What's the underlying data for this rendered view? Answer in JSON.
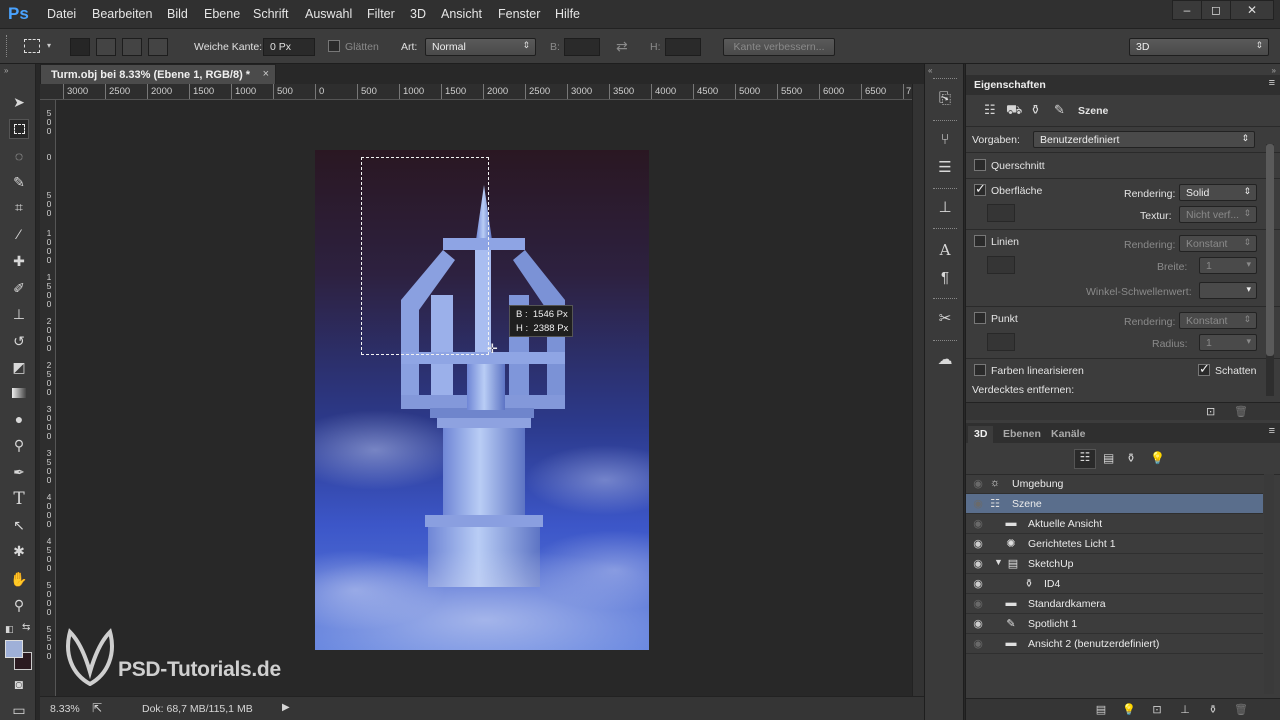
{
  "app": {
    "logo": "Ps"
  },
  "menu": [
    "Datei",
    "Bearbeiten",
    "Bild",
    "Ebene",
    "Schrift",
    "Auswahl",
    "Filter",
    "3D",
    "Ansicht",
    "Fenster",
    "Hilfe"
  ],
  "options": {
    "feather_label": "Weiche Kante:",
    "feather_value": "0 Px",
    "antialias_label": "Glätten",
    "style_label": "Art:",
    "style_value": "Normal",
    "width_label": "B:",
    "height_label": "H:",
    "refine_edge": "Kante verbessern...",
    "workspace": "3D"
  },
  "document": {
    "tab_title": "Turm.obj bei 8.33% (Ebene 1, RGB/8) *",
    "ruler_top": [
      "3000",
      "2500",
      "2000",
      "1500",
      "1000",
      "500",
      "0",
      "500",
      "1000",
      "1500",
      "2000",
      "2500",
      "3000",
      "3500",
      "4000",
      "4500",
      "5000",
      "5500",
      "6000",
      "6500",
      "7"
    ],
    "ruler_left": [
      "500",
      "0",
      "500",
      "1000",
      "1500",
      "2000",
      "2500",
      "3000",
      "3500",
      "4000",
      "4500",
      "5000",
      "5500"
    ],
    "tooltip_w": "B :  1546 Px",
    "tooltip_h": "H :  2388 Px",
    "zoom": "8.33%",
    "doc_size": "Dok: 68,7 MB/115,1 MB"
  },
  "watermark": "PSD-Tutorials.de",
  "properties": {
    "tab": "Eigenschaften",
    "section": "Szene",
    "presets_label": "Vorgaben:",
    "presets_value": "Benutzerdefiniert",
    "cross_section": "Querschnitt",
    "surface": "Oberfläche",
    "rendering_label": "Rendering:",
    "surface_rendering": "Solid",
    "texture_label": "Textur:",
    "texture_value": "Nicht verf...",
    "lines": "Linien",
    "lines_rendering": "Konstant",
    "width_label": "Breite:",
    "width_value": "1",
    "angle_label": "Winkel-Schwellenwert:",
    "point": "Punkt",
    "point_rendering": "Konstant",
    "radius_label": "Radius:",
    "radius_value": "1",
    "linearize": "Farben linearisieren",
    "shadows": "Schatten",
    "remove_hidden": "Verdecktes entfernen:"
  },
  "panel3d": {
    "tabs": [
      "3D",
      "Ebenen",
      "Kanäle"
    ],
    "items": [
      {
        "name": "Umgebung"
      },
      {
        "name": "Szene"
      },
      {
        "name": "Aktuelle Ansicht"
      },
      {
        "name": "Gerichtetes Licht 1"
      },
      {
        "name": "SketchUp"
      },
      {
        "name": "ID4"
      },
      {
        "name": "Standardkamera"
      },
      {
        "name": "Spotlicht 1"
      },
      {
        "name": "Ansicht 2 (benutzerdefiniert)"
      }
    ]
  }
}
